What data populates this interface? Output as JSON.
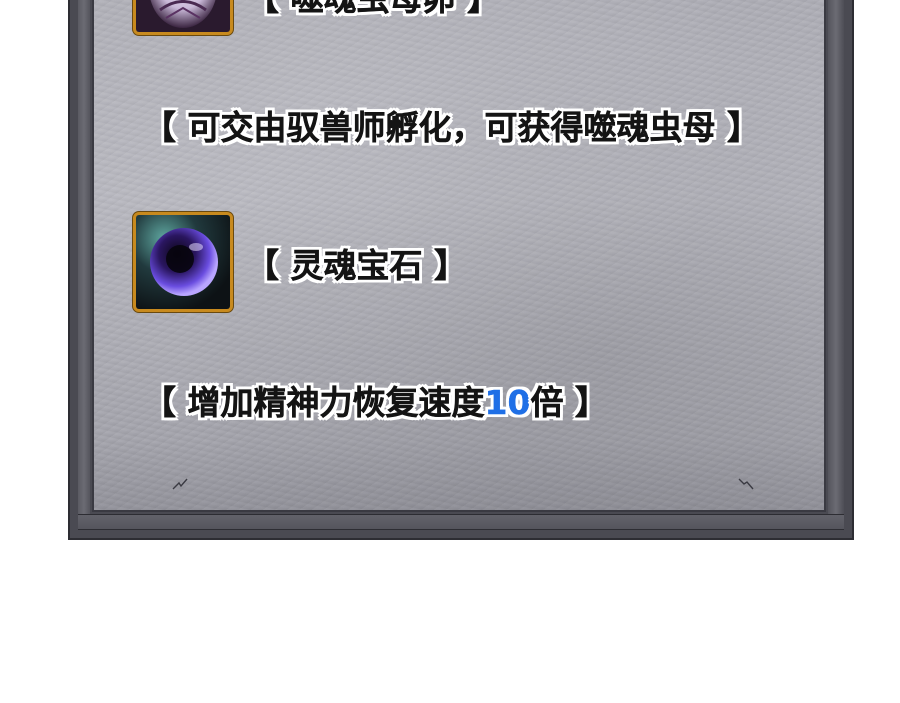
{
  "panel": {
    "item1": {
      "name_line": "【 噬魂虫母卵 】",
      "icon": "egg-icon",
      "description": "【 可交由驭兽师孵化，可获得噬魂虫母 】"
    },
    "item2": {
      "name_line": "【 灵魂宝石 】",
      "icon": "soul-gem-icon",
      "description_prefix": "【 增加精神力恢复速度",
      "description_number": "10",
      "description_suffix": "倍 】"
    }
  },
  "colors": {
    "text": "#141414",
    "text_outline": "#ffffff",
    "number_accent": "#1f6fe6",
    "icon_border": "#c88a1e",
    "panel_stone": "#b0b0b8",
    "frame": "#4a4a52"
  }
}
